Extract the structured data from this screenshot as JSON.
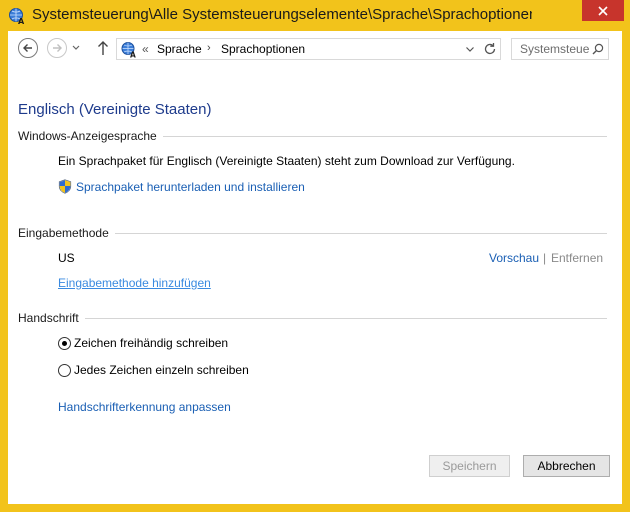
{
  "window": {
    "title": "Systemsteuerung\\Alle Systemsteuerungselemente\\Sprache\\Sprachoptionen",
    "accent_color": "#f2c31b",
    "close_color": "#c7342c"
  },
  "nav": {
    "breadcrumb_overflow": "«",
    "breadcrumbs": [
      "Sprache",
      "Sprachoptionen"
    ],
    "breadcrumb_separator": "›",
    "search_placeholder": "Systemsteuerung durchsuchen"
  },
  "page": {
    "title": "Englisch (Vereinigte Staaten)",
    "display_language": {
      "heading": "Windows-Anzeigesprache",
      "message": "Ein Sprachpaket für Englisch (Vereinigte Staaten) steht zum Download zur Verfügung.",
      "download_link": "Sprachpaket herunterladen und installieren"
    },
    "input_method": {
      "heading": "Eingabemethode",
      "item": "US",
      "preview_link": "Vorschau",
      "separator": "|",
      "remove_link": "Entfernen",
      "add_link": "Eingabemethode hinzufügen"
    },
    "handwriting": {
      "heading": "Handschrift",
      "options": [
        {
          "label": "Zeichen freihändig schreiben",
          "checked": true
        },
        {
          "label": "Jedes Zeichen einzeln schreiben",
          "checked": false
        }
      ],
      "customize_link": "Handschrifterkennung anpassen"
    }
  },
  "footer": {
    "save_label": "Speichern",
    "cancel_label": "Abbrechen"
  }
}
